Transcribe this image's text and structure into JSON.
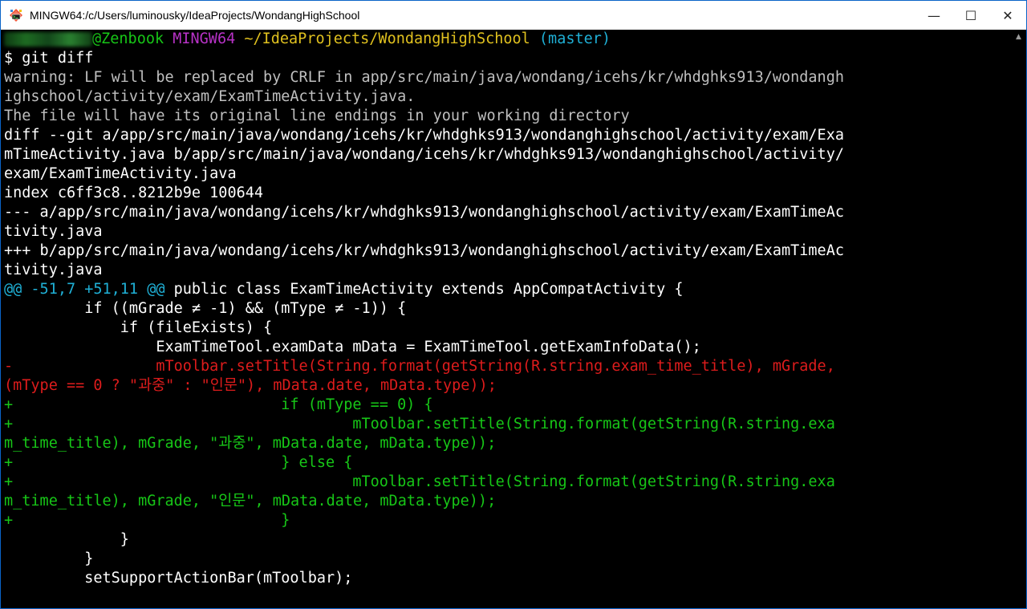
{
  "window": {
    "title": "MINGW64:/c/Users/luminousky/IdeaProjects/WondangHighSchool",
    "minimize_glyph": "—",
    "maximize_glyph": "☐",
    "close_glyph": "✕"
  },
  "prompt": {
    "host": "@Zenbook",
    "env": "MINGW64",
    "path": "~/IdeaProjects/WondangHighSchool",
    "branch": "(master)",
    "symbol": "$",
    "command": "git diff"
  },
  "output": {
    "warning_1": "warning: LF will be replaced by CRLF in app/src/main/java/wondang/icehs/kr/whdghks913/wondangh",
    "warning_2": "ighschool/activity/exam/ExamTimeActivity.java.",
    "warning_3": "The file will have its original line endings in your working directory",
    "diff_git_1": "diff --git a/app/src/main/java/wondang/icehs/kr/whdghks913/wondanghighschool/activity/exam/Exa",
    "diff_git_2": "mTimeActivity.java b/app/src/main/java/wondang/icehs/kr/whdghks913/wondanghighschool/activity/",
    "diff_git_3": "exam/ExamTimeActivity.java",
    "index_line": "index c6ff3c8..8212b9e 100644",
    "minus_file_1": "--- a/app/src/main/java/wondang/icehs/kr/whdghks913/wondanghighschool/activity/exam/ExamTimeAc",
    "minus_file_2": "tivity.java",
    "plus_file_1": "+++ b/app/src/main/java/wondang/icehs/kr/whdghks913/wondanghighschool/activity/exam/ExamTimeAc",
    "plus_file_2": "tivity.java",
    "hunk_header": "@@ -51,7 +51,11 @@",
    "hunk_context": " public class ExamTimeActivity extends AppCompatActivity {",
    "ctx_1": "         if ((mGrade ≠ -1) && (mType ≠ -1)) {",
    "ctx_2": "             if (fileExists) {",
    "ctx_3": "                 ExamTimeTool.examData mData = ExamTimeTool.getExamInfoData();",
    "del_1": "-                mToolbar.setTitle(String.format(getString(R.string.exam_time_title), mGrade,",
    "del_2": "(mType == 0 ? \"과중\" : \"인문\"), mData.date, mData.type));",
    "add_1": "+                              if (mType == 0) {",
    "add_2": "+                                      mToolbar.setTitle(String.format(getString(R.string.exa",
    "add_3": "m_time_title), mGrade, \"과중\", mData.date, mData.type));",
    "add_4": "+                              } else {",
    "add_5": "+                                      mToolbar.setTitle(String.format(getString(R.string.exa",
    "add_6": "m_time_title), mGrade, \"인문\", mData.date, mData.type));",
    "add_7": "+                              }",
    "ctx_4": "             }",
    "ctx_5": "         }",
    "ctx_6": "         setSupportActionBar(mToolbar);"
  },
  "colors": {
    "background": "#000000",
    "deleted": "#dd1c1c",
    "added": "#17c617",
    "hunk": "#1fb0d6",
    "env": "#b732c6",
    "path": "#e0c11f",
    "user": "#1e6b22"
  },
  "icons": {
    "app": "git-bash-icon",
    "scroll_up": "scroll-up-arrow-icon"
  }
}
